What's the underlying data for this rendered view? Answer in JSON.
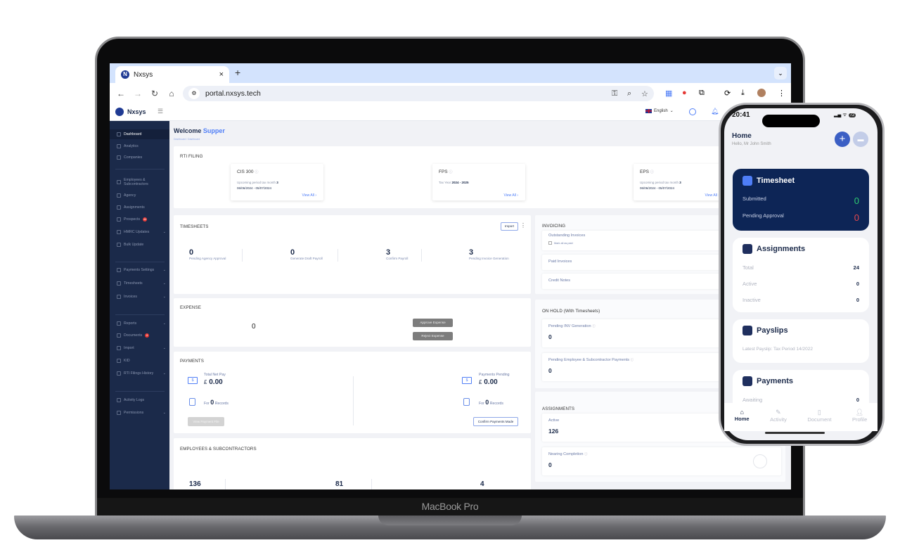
{
  "device": {
    "laptop_label": "MacBook Pro"
  },
  "browser": {
    "tab_title": "Nxsys",
    "url": "portal.nxsys.tech",
    "new_tab": "+",
    "close": "×"
  },
  "app": {
    "brand": "Nxsys",
    "language": "English",
    "welcome_prefix": "Welcome ",
    "user_name": "Supper",
    "breadcrumb": "Dashboard / Dashboard",
    "sidebar": [
      {
        "label": "Dashboard",
        "active": true
      },
      {
        "label": "Analytics"
      },
      {
        "label": "Companies"
      },
      {
        "label": "Employees & Subcontractors"
      },
      {
        "label": "Agency"
      },
      {
        "label": "Assignments"
      },
      {
        "label": "Prospects",
        "badge": "44"
      },
      {
        "label": "HMRC Updates",
        "chevron": true
      },
      {
        "label": "Bulk Update"
      },
      {
        "label": "Payments Settings",
        "chevron": true
      },
      {
        "label": "Timesheets",
        "chevron": true
      },
      {
        "label": "Invoices",
        "chevron": true
      },
      {
        "label": "Reports",
        "chevron": true
      },
      {
        "label": "Documents",
        "badge": "8"
      },
      {
        "label": "Import",
        "chevron": true
      },
      {
        "label": "KID"
      },
      {
        "label": "RTI Filings History",
        "chevron": true
      },
      {
        "label": "Activity Logs"
      },
      {
        "label": "Permissions",
        "chevron": true
      }
    ],
    "rti": {
      "title": "RTI FILING",
      "cards": [
        {
          "title": "CIS 300",
          "sub_label": "Upcoming period tax month",
          "sub_value": "3",
          "dates": "06/06/2024 - 05/07/2024",
          "link": "View All ›"
        },
        {
          "title": "FPS",
          "sub_label": "Tax Year",
          "sub_value": "2024 - 2025",
          "dates": "",
          "link": "View All ›"
        },
        {
          "title": "EPS",
          "sub_label": "Upcoming period tax month",
          "sub_value": "3",
          "dates": "06/06/2024 - 05/07/2024",
          "link": "View All ›"
        }
      ]
    },
    "timesheets": {
      "title": "TIMESHEETS",
      "import_label": "Import",
      "stats": [
        {
          "value": "0",
          "label": "Pending Agency Approval"
        },
        {
          "value": "0",
          "label": "Generate Draft Payroll"
        },
        {
          "value": "3",
          "label": "Confirm Payroll"
        },
        {
          "value": "3",
          "label": "Pending Invoice Generation"
        }
      ]
    },
    "expense": {
      "title": "EXPENSE",
      "value": "0",
      "approve": "Approve Expense",
      "reject": "Reject Expense"
    },
    "payments": {
      "title": "PAYMENTS",
      "left": {
        "label": "Total Net Pay",
        "currency": "£",
        "amount": "0.00",
        "for": "For",
        "records": "0",
        "records_label": "Records",
        "button": "View Payment File"
      },
      "right": {
        "label": "Payments Pending",
        "currency": "£",
        "amount": "0.00",
        "for": "For",
        "records": "0",
        "records_label": "Records",
        "button": "Confirm Payments Made"
      }
    },
    "employees": {
      "title": "EMPLOYEES & SUBCONTRACTORS",
      "values": [
        "136",
        "81",
        "4"
      ]
    },
    "invoicing": {
      "title": "INVOICING",
      "items": [
        "Outstanding Invoices",
        "Paid Invoices",
        "Credit Notes"
      ],
      "mark_paid": "Mark all as paid"
    },
    "on_hold": {
      "title": "ON HOLD (With Timesheets)",
      "items": [
        {
          "label": "Pending INV Generation",
          "value": "0"
        },
        {
          "label": "Pending Employee & Subcontractor Payments",
          "value": "0"
        }
      ]
    },
    "assignments": {
      "title": "ASSIGNMENTS",
      "items": [
        {
          "label": "Active",
          "value": "126"
        },
        {
          "label": "Nearing Completion",
          "value": "0"
        }
      ]
    }
  },
  "phone": {
    "time": "20:41",
    "battery": "72",
    "title": "Home",
    "greeting": "Hello, Mr John Smith",
    "timesheet": {
      "title": "Timesheet",
      "rows": [
        {
          "label": "Submitted",
          "value": "0",
          "color": "#2ecc71"
        },
        {
          "label": "Pending Approval",
          "value": "0",
          "color": "#e5484d"
        }
      ]
    },
    "assignments": {
      "title": "Assignments",
      "rows": [
        {
          "label": "Total",
          "value": "24"
        },
        {
          "label": "Active",
          "value": "0"
        },
        {
          "label": "Inactive",
          "value": "0"
        }
      ]
    },
    "payslips": {
      "title": "Payslips",
      "latest": "Latest Payslip: Tax Period 14/2022"
    },
    "payments": {
      "title": "Payments",
      "rows": [
        {
          "label": "Awaiting",
          "value": "0"
        }
      ]
    },
    "nav": [
      "Home",
      "Activity",
      "Document",
      "Profile"
    ]
  }
}
